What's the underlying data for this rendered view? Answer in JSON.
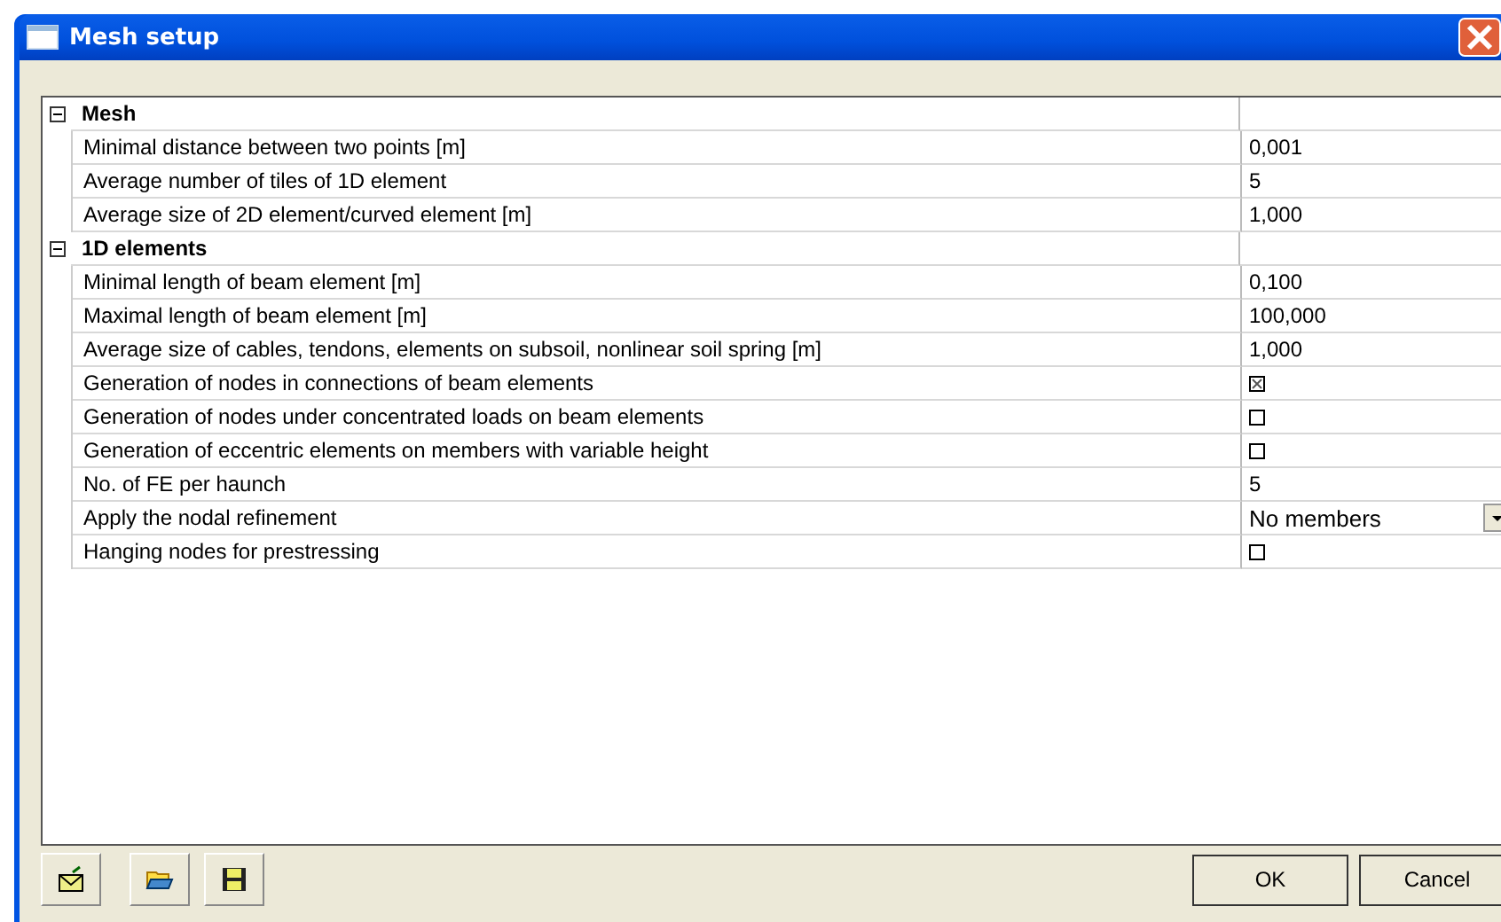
{
  "window": {
    "title": "Mesh setup"
  },
  "groups": [
    {
      "title": "Mesh",
      "expanded": true,
      "rows": [
        {
          "kind": "text",
          "label": "Minimal distance between two points [m]",
          "value": "0,001"
        },
        {
          "kind": "text",
          "label": "Average number of tiles of 1D element",
          "value": "5"
        },
        {
          "kind": "text",
          "label": "Average size of 2D element/curved element [m]",
          "value": "1,000"
        }
      ]
    },
    {
      "title": "1D elements",
      "expanded": true,
      "rows": [
        {
          "kind": "text",
          "label": "Minimal length of beam element [m]",
          "value": "0,100"
        },
        {
          "kind": "text",
          "label": "Maximal length of beam element [m]",
          "value": "100,000"
        },
        {
          "kind": "text",
          "label": "Average size of cables, tendons, elements on subsoil, nonlinear soil spring [m]",
          "value": "1,000"
        },
        {
          "kind": "checkbox",
          "label": "Generation of nodes in connections of beam elements",
          "checked": true
        },
        {
          "kind": "checkbox",
          "label": "Generation of nodes under concentrated loads on beam elements",
          "checked": false
        },
        {
          "kind": "checkbox",
          "label": "Generation of eccentric elements on members with variable height",
          "checked": false
        },
        {
          "kind": "text",
          "label": "No. of FE per haunch",
          "value": "5"
        },
        {
          "kind": "dropdown",
          "label": "Apply the nodal refinement",
          "value": "No members"
        },
        {
          "kind": "checkbox",
          "label": "Hanging nodes for prestressing",
          "checked": false
        }
      ]
    }
  ],
  "buttons": [
    {
      "label": "OK"
    },
    {
      "label": "Cancel"
    }
  ]
}
